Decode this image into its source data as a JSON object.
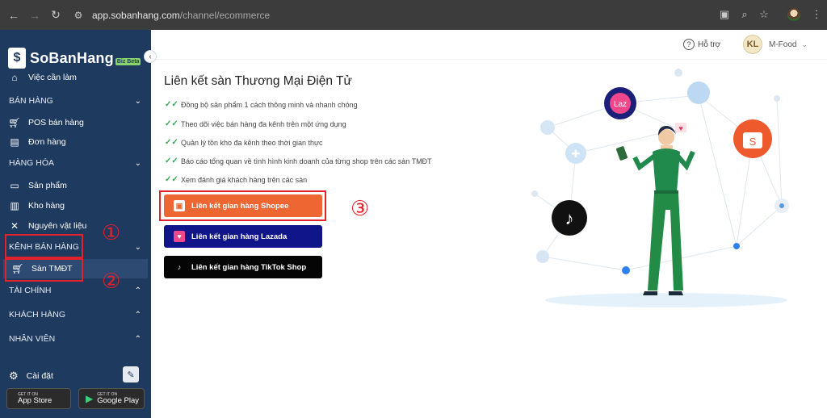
{
  "browser": {
    "url_domain": "app.sobanhang.com",
    "url_path": "/channel/ecommerce"
  },
  "brand": {
    "name": "SoBanHang",
    "badge": "Biz Beta",
    "logo_glyph": "$"
  },
  "sidebar": {
    "top_item": {
      "label": "Việc cần làm",
      "icon": "home-icon"
    },
    "sections": [
      {
        "title": "BÁN HÀNG",
        "items": [
          {
            "label": "POS bán hàng",
            "icon": "cart-icon"
          },
          {
            "label": "Đơn hàng",
            "icon": "document-icon"
          }
        ]
      },
      {
        "title": "HÀNG HÓA",
        "items": [
          {
            "label": "Sản phẩm",
            "icon": "box-icon"
          },
          {
            "label": "Kho hàng",
            "icon": "warehouse-icon"
          },
          {
            "label": "Nguyên vật liệu",
            "icon": "utensils-icon"
          }
        ]
      },
      {
        "title": "KÊNH BÁN HÀNG",
        "items": [
          {
            "label": "Sàn TMĐT",
            "icon": "cart-icon"
          }
        ]
      },
      {
        "title": "TÀI CHÍNH",
        "items": []
      },
      {
        "title": "KHÁCH HÀNG",
        "items": []
      },
      {
        "title": "NHÂN VIÊN",
        "items": []
      }
    ],
    "settings_label": "Cài đặt",
    "app_store": {
      "small": "GET IT ON",
      "big": "App Store"
    },
    "google_play": {
      "small": "GET IT ON",
      "big": "Google Play"
    }
  },
  "header": {
    "help_label": "Hỗ trợ",
    "user_name": "M-Food",
    "avatar_initials": "KL"
  },
  "main": {
    "title": "Liên kết sàn Thương Mại Điện Tử",
    "features": [
      "Đồng bộ sản phẩm 1 cách thông minh và nhanh chóng",
      "Theo dõi việc bán hàng đa kênh trên một ứng dụng",
      "Quản lý tồn kho đa kênh theo thời gian thực",
      "Báo cáo tổng quan về tình hình kinh doanh của từng shop trên các sàn TMĐT",
      "Xem đánh giá khách hàng trên các sàn"
    ],
    "buttons": {
      "shopee": "Liên kết gian hàng Shopee",
      "lazada": "Liên kết gian hàng Lazada",
      "tiktok": "Liên kết gian hàng TikTok Shop"
    }
  },
  "annotations": {
    "one": "①",
    "two": "②",
    "three": "③"
  },
  "illustration": {
    "lazada_logo_text": "Laz",
    "shopee_logo_text": "S"
  },
  "colors": {
    "sidebar_bg": "#1e3a5f",
    "shopee": "#ee6733",
    "lazada": "#10158a",
    "tiktok": "#050505",
    "check": "#3aa556",
    "annotation_red": "#e0222a"
  }
}
